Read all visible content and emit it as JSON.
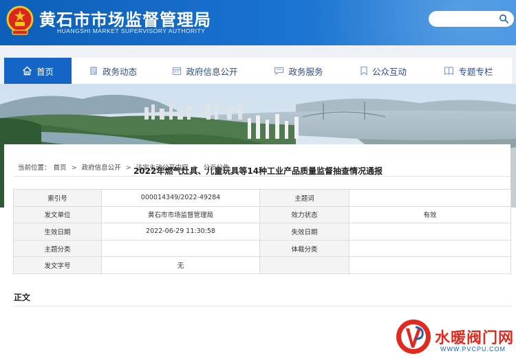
{
  "header": {
    "title": "黄石市市场监督管理局",
    "subtitle": "HUANGSHI MARKET SUPERVISORY AUTHORITY",
    "search": {
      "placeholder": ""
    }
  },
  "nav": {
    "items": [
      {
        "label": "首页",
        "icon": "home-icon",
        "active": true
      },
      {
        "label": "政务动态",
        "icon": "document-list-icon"
      },
      {
        "label": "政府信息公开",
        "icon": "calendar-icon"
      },
      {
        "label": "政务服务",
        "icon": "chat-icon"
      },
      {
        "label": "公众互动",
        "icon": "bookmark-icon"
      },
      {
        "label": "专题专栏",
        "icon": "book-icon"
      }
    ]
  },
  "breadcrumb": {
    "prefix": "当前位置：",
    "items": [
      "首页",
      "政府信息公开",
      "法定主动公开内容",
      "公示公告"
    ],
    "separator": ">"
  },
  "meta_table": {
    "rows": [
      {
        "label1": "索引号",
        "value1": "000014349/2022-49284",
        "label2": "主题词",
        "value2": ""
      },
      {
        "label1": "发文单位",
        "value1": "黄石市市场监督管理局",
        "label2": "效力状态",
        "value2": "有效"
      },
      {
        "label1": "生效日期",
        "value1": "2022-06-29 11:30:58",
        "label2": "失效日期",
        "value2": ""
      },
      {
        "label1": "主题分类",
        "value1": "",
        "label2": "体裁分类",
        "value2": ""
      },
      {
        "label1": "发文字号",
        "value1": "无",
        "label2": "",
        "value2": ""
      }
    ]
  },
  "content": {
    "section_label": "正文",
    "doc_title": "2022年燃气灶具、儿童玩具等14种工业产品质量监督抽查情况通报"
  },
  "watermark": {
    "text": "水暖阀门网",
    "url": "WWW.PVCPU.COM"
  },
  "colors": {
    "header_blue": "#1565c6",
    "nav_text": "#2b4e85",
    "watermark_red": "#e02a1f"
  }
}
